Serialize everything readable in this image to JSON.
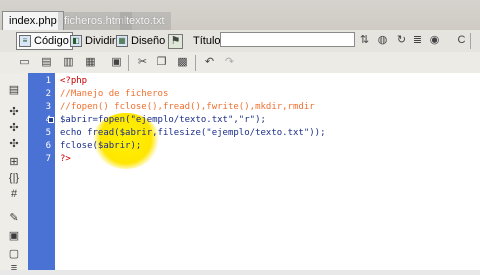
{
  "tabs": [
    {
      "label": "index.php",
      "active": true
    },
    {
      "label": "ficheros.html",
      "active": false
    },
    {
      "label": "texto.txt",
      "active": false
    }
  ],
  "toolbar": {
    "code_label": "Código",
    "split_label": "Dividir",
    "design_label": "Diseño",
    "title_label": "Título:",
    "title_value": ""
  },
  "editor": {
    "line_numbers": [
      "1",
      "2",
      "3",
      "4",
      "5",
      "6",
      "7"
    ],
    "lines": [
      "<?php",
      "//Manejo de ficheros",
      "//fopen() fclose(),fread(),fwrite(),mkdir,rmdir",
      "$abrir=fopen(\"ejemplo/texto.txt\",\"r\");",
      "echo fread($abrir,filesize(\"ejemplo/texto.txt\"));",
      "fclose($abrir);",
      "?>"
    ]
  },
  "colors": {
    "gutter": "#4a72d4",
    "php_tag": "#cc0000",
    "comment": "#f07030",
    "keyword": "#1b2e8a",
    "string": "#1f7a1f",
    "highlight": "#ffe600"
  }
}
